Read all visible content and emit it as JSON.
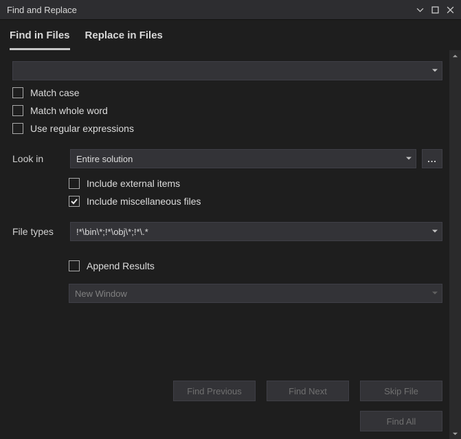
{
  "window": {
    "title": "Find and Replace"
  },
  "tabs": {
    "find": "Find in Files",
    "replace": "Replace in Files",
    "active": "find"
  },
  "search": {
    "value": ""
  },
  "options": {
    "match_case": "Match case",
    "match_whole_word": "Match whole word",
    "use_regex": "Use regular expressions"
  },
  "look_in": {
    "label": "Look in",
    "value": "Entire solution",
    "browse": "...",
    "include_external": "Include external items",
    "include_misc": "Include miscellaneous files",
    "include_misc_checked": true
  },
  "file_types": {
    "label": "File types",
    "value": "!*\\bin\\*;!*\\obj\\*;!*\\.*"
  },
  "results": {
    "append": "Append Results",
    "window": "New Window"
  },
  "buttons": {
    "find_previous": "Find Previous",
    "find_next": "Find Next",
    "skip_file": "Skip File",
    "find_all": "Find All"
  }
}
